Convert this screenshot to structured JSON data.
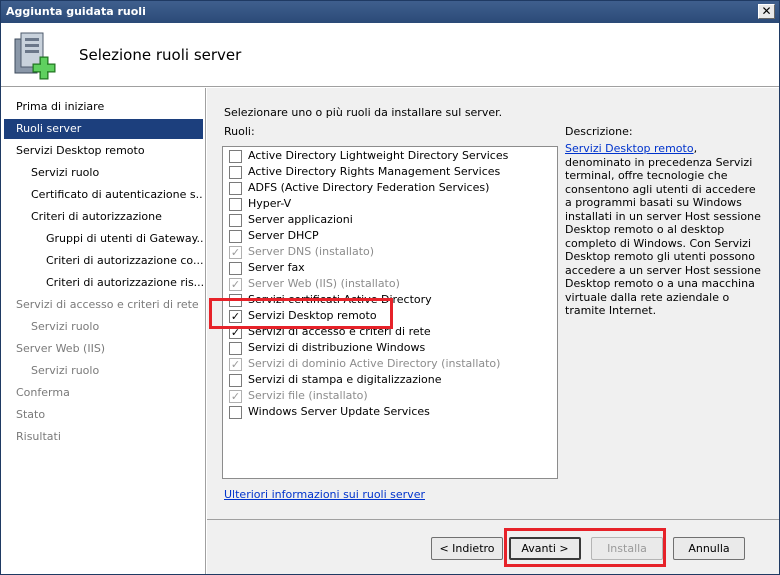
{
  "window": {
    "title": "Aggiunta guidata ruoli",
    "close_glyph": "✕"
  },
  "header": {
    "title": "Selezione ruoli server",
    "icon": "server-add-icon"
  },
  "sidebar": {
    "items": [
      {
        "label": "Prima di iniziare",
        "level": 0,
        "state": "normal"
      },
      {
        "label": "Ruoli server",
        "level": 0,
        "state": "active"
      },
      {
        "label": "Servizi Desktop remoto",
        "level": 0,
        "state": "normal"
      },
      {
        "label": "Servizi ruolo",
        "level": 1,
        "state": "normal"
      },
      {
        "label": "Certificato di autenticazione s...",
        "level": 1,
        "state": "normal"
      },
      {
        "label": "Criteri di autorizzazione",
        "level": 1,
        "state": "normal"
      },
      {
        "label": "Gruppi di utenti di Gateway...",
        "level": 2,
        "state": "normal"
      },
      {
        "label": "Criteri di autorizzazione co...",
        "level": 2,
        "state": "normal"
      },
      {
        "label": "Criteri di autorizzazione ris...",
        "level": 2,
        "state": "normal"
      },
      {
        "label": "Servizi di accesso e criteri di rete",
        "level": 0,
        "state": "disabled"
      },
      {
        "label": "Servizi ruolo",
        "level": 1,
        "state": "disabled"
      },
      {
        "label": "Server Web (IIS)",
        "level": 0,
        "state": "disabled"
      },
      {
        "label": "Servizi ruolo",
        "level": 1,
        "state": "disabled"
      },
      {
        "label": "Conferma",
        "level": 0,
        "state": "disabled"
      },
      {
        "label": "Stato",
        "level": 0,
        "state": "disabled"
      },
      {
        "label": "Risultati",
        "level": 0,
        "state": "disabled"
      }
    ]
  },
  "main": {
    "intro": "Selezionare uno o più ruoli da installare sul server.",
    "roles_label": "Ruoli:",
    "description_label": "Descrizione:",
    "roles": [
      {
        "label": "Active Directory Lightweight Directory Services",
        "checked": false,
        "disabled": false
      },
      {
        "label": "Active Directory Rights Management Services",
        "checked": false,
        "disabled": false
      },
      {
        "label": "ADFS (Active Directory Federation Services)",
        "checked": false,
        "disabled": false
      },
      {
        "label": "Hyper-V",
        "checked": false,
        "disabled": false
      },
      {
        "label": "Server applicazioni",
        "checked": false,
        "disabled": false
      },
      {
        "label": "Server DHCP",
        "checked": false,
        "disabled": false
      },
      {
        "label": "Server DNS  (installato)",
        "checked": true,
        "disabled": true
      },
      {
        "label": "Server fax",
        "checked": false,
        "disabled": false
      },
      {
        "label": "Server Web (IIS)  (installato)",
        "checked": true,
        "disabled": true
      },
      {
        "label": "Servizi certificati Active Directory",
        "checked": false,
        "disabled": false
      },
      {
        "label": "Servizi Desktop remoto",
        "checked": true,
        "disabled": false
      },
      {
        "label": "Servizi di accesso e criteri di rete",
        "checked": true,
        "disabled": false
      },
      {
        "label": "Servizi di distribuzione Windows",
        "checked": false,
        "disabled": false
      },
      {
        "label": "Servizi di dominio Active Directory  (installato)",
        "checked": true,
        "disabled": true
      },
      {
        "label": "Servizi di stampa e digitalizzazione",
        "checked": false,
        "disabled": false
      },
      {
        "label": "Servizi file  (installato)",
        "checked": true,
        "disabled": true
      },
      {
        "label": "Windows Server Update Services",
        "checked": false,
        "disabled": false
      }
    ],
    "description": {
      "link": "Servizi Desktop remoto",
      "text": ", denominato in precedenza Servizi terminal, offre tecnologie che consentono agli utenti di accedere a programmi basati su Windows installati in un server Host sessione Desktop remoto o al desktop completo di Windows. Con Servizi Desktop remoto gli utenti possono accedere a un server Host sessione Desktop remoto o a una macchina virtuale dalla rete aziendale o tramite Internet."
    },
    "more_info_link": "Ulteriori informazioni sui ruoli server"
  },
  "footer": {
    "back_label": "< Indietro",
    "next_label": "Avanti >",
    "install_label": "Installa",
    "cancel_label": "Annulla"
  },
  "colors": {
    "highlight": "#e62229",
    "active_nav": "#1c3f7d",
    "link": "#0033cc"
  }
}
